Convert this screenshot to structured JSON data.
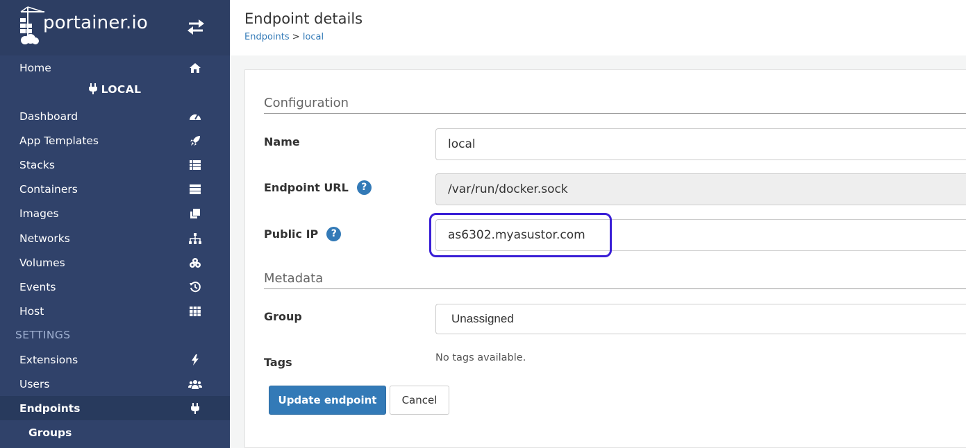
{
  "brand": {
    "name": "portainer.io"
  },
  "sidebar": {
    "home": "Home",
    "endpoint_name": "LOCAL",
    "items": [
      {
        "label": "Dashboard",
        "icon": "tachometer-icon"
      },
      {
        "label": "App Templates",
        "icon": "rocket-icon"
      },
      {
        "label": "Stacks",
        "icon": "th-list-icon"
      },
      {
        "label": "Containers",
        "icon": "server-icon"
      },
      {
        "label": "Images",
        "icon": "clone-icon"
      },
      {
        "label": "Networks",
        "icon": "sitemap-icon"
      },
      {
        "label": "Volumes",
        "icon": "cubes-icon"
      },
      {
        "label": "Events",
        "icon": "history-icon"
      },
      {
        "label": "Host",
        "icon": "th-icon"
      }
    ],
    "settings_heading": "SETTINGS",
    "settings_items": [
      {
        "label": "Extensions",
        "icon": "bolt-icon"
      },
      {
        "label": "Users",
        "icon": "users-icon"
      },
      {
        "label": "Endpoints",
        "icon": "plug-icon"
      },
      {
        "label": "Groups"
      }
    ]
  },
  "header": {
    "title": "Endpoint details",
    "breadcrumb_link": "Endpoints",
    "breadcrumb_sep": ">",
    "breadcrumb_current": "local"
  },
  "form": {
    "configuration_legend": "Configuration",
    "name_label": "Name",
    "name_value": "local",
    "url_label": "Endpoint URL",
    "url_value": "/var/run/docker.sock",
    "public_ip_label": "Public IP",
    "public_ip_value": "as6302.myasustor.com",
    "metadata_legend": "Metadata",
    "group_label": "Group",
    "group_value": "Unassigned",
    "tags_label": "Tags",
    "tags_empty": "No tags available.",
    "help_glyph": "?",
    "update_button": "Update endpoint",
    "cancel_button": "Cancel"
  },
  "colors": {
    "sidebar_bg": "#30426a",
    "accent": "#337ab7",
    "highlight": "#3a1fd6"
  }
}
